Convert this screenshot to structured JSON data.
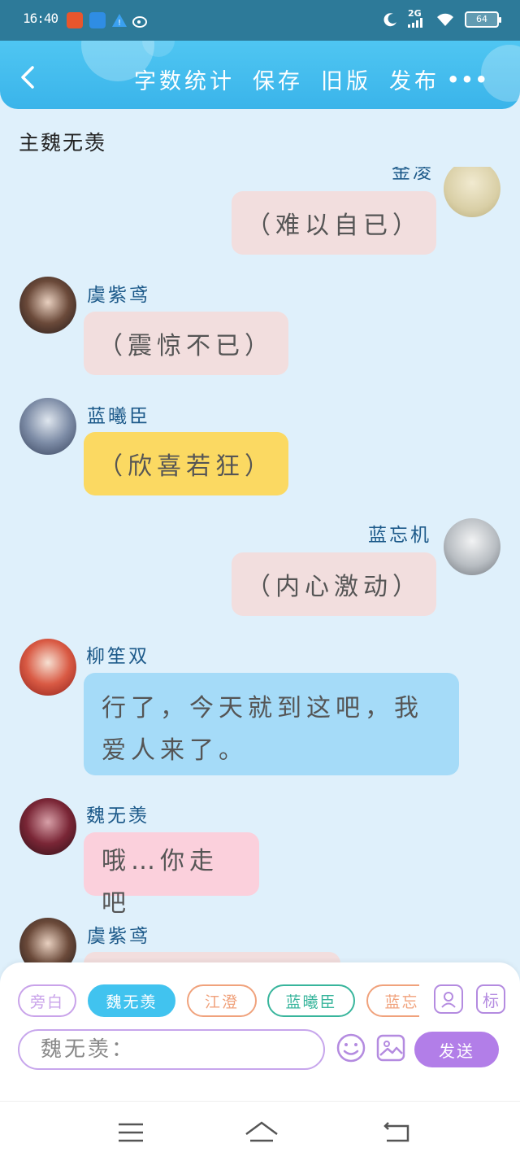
{
  "status_bar": {
    "time": "16:40",
    "network": "2G",
    "battery": "64"
  },
  "header": {
    "back_label": "<",
    "actions": [
      "字数统计",
      "保存",
      "旧版",
      "发布"
    ],
    "more_label": "•••"
  },
  "protagonist": "主魏无羡",
  "messages": [
    {
      "side": "right",
      "name": "金凌",
      "text": "（难以自已）",
      "bubble_color": "#f2dede",
      "avatar_color": "#d9cfa6"
    },
    {
      "side": "left",
      "name": "虞紫鸢",
      "text": "（震惊不已）",
      "bubble_color": "#f2dede",
      "avatar_color": "#3a2a2a"
    },
    {
      "side": "left",
      "name": "蓝曦臣",
      "text": "（欣喜若狂）",
      "bubble_color": "#fbd962",
      "avatar_color": "#5b6c88"
    },
    {
      "side": "right",
      "name": "蓝忘机",
      "text": "（内心激动）",
      "bubble_color": "#f2dede",
      "avatar_color": "#b8bdc2"
    },
    {
      "side": "left",
      "name": "柳笙双",
      "text": "行了，今天就到这吧，我爱人来了。",
      "bubble_color": "#a5dbf8",
      "avatar_color": "#c2342b"
    },
    {
      "side": "left",
      "name": "魏无羡",
      "text": "哦…你走吧",
      "bubble_color": "#fbd0dc",
      "avatar_color": "#5a1e2a"
    },
    {
      "side": "left",
      "name": "虞紫鸢",
      "text": "",
      "bubble_color": "#f2dede",
      "avatar_color": "#3a2a2a"
    }
  ],
  "roles": [
    {
      "label": "旁白",
      "color": "#c9a3ea",
      "active": false
    },
    {
      "label": "魏无羡",
      "color": "#41c3ef",
      "active": true
    },
    {
      "label": "江澄",
      "color": "#f0a27c",
      "active": false
    },
    {
      "label": "蓝曦臣",
      "color": "#38b59c",
      "active": false
    },
    {
      "label": "蓝忘机",
      "color": "#f0a27c",
      "active": false
    }
  ],
  "tools": {
    "character_icon": "person-card-icon",
    "tag_label": "标"
  },
  "input": {
    "prefix": "魏无羡：",
    "placeholder": ""
  },
  "send_label": "发送",
  "navbar": {
    "items": [
      "menu-icon",
      "home-icon",
      "back-icon"
    ]
  }
}
